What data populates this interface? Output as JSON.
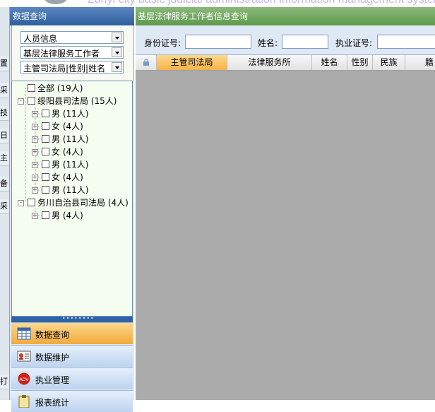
{
  "banner": {
    "text": "Zunyi city basic judicial administration information management system"
  },
  "left_edge": {
    "glyphs": [
      "置",
      "采",
      "技",
      "日",
      "主",
      "备",
      "采",
      "打"
    ]
  },
  "sidebar": {
    "title": "数据查询",
    "filters": [
      "人员信息",
      "基层法律服务工作者",
      "主管司法局|性别|姓名"
    ],
    "tree": [
      {
        "label": "全部 (19人)"
      },
      {
        "label": "绥阳县司法局 (15人)"
      },
      {
        "label": "男 (11人)"
      },
      {
        "label": "女 (4人)"
      },
      {
        "label": "男 (11人)"
      },
      {
        "label": "女 (4人)"
      },
      {
        "label": "男 (11人)"
      },
      {
        "label": "女 (4人)"
      },
      {
        "label": "男 (11人)"
      },
      {
        "label": "务川自治县司法局 (4人)"
      },
      {
        "label": "男 (4人)"
      }
    ],
    "menu": [
      {
        "label": "数据查询",
        "icon": "calendar-grid-icon"
      },
      {
        "label": "数据维护",
        "icon": "id-card-icon"
      },
      {
        "label": "执业管理",
        "icon": "adv-badge-icon"
      },
      {
        "label": "报表统计",
        "icon": "clipboard-icon"
      }
    ]
  },
  "main": {
    "title": "基层法律服务工作者信息查询",
    "search": {
      "id_label": "身份证号:",
      "name_label": "姓名:",
      "license_label": "执业证号:"
    },
    "columns": [
      "主管司法局",
      "法律服务所",
      "姓名",
      "性别",
      "民族",
      "籍"
    ]
  },
  "colors": {
    "sidebar_title": "#2f5f9e",
    "main_title": "#5e9a4c",
    "active_menu": "#f2a93b",
    "grid_bg": "#ababab"
  }
}
